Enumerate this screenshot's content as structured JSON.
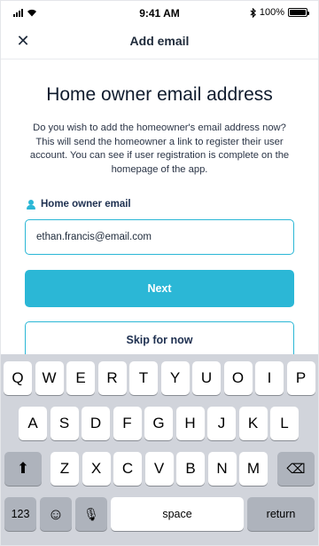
{
  "status_bar": {
    "time": "9:41 AM",
    "battery": "100%",
    "signal_icon": "signal-icon",
    "wifi_icon": "wifi-icon",
    "bluetooth_icon": "bluetooth-icon"
  },
  "nav": {
    "title": "Add email",
    "close_symbol": "✕"
  },
  "page": {
    "heading": "Home owner email address",
    "description": "Do you wish to add the homeowner's email address now? This will send the homeowner a link to register their user account. You can see if user registration is complete on the homepage of the app."
  },
  "form": {
    "field_label": "Home owner email",
    "email_value": "ethan.francis@email.com",
    "next_label": "Next",
    "skip_label": "Skip for now"
  },
  "keyboard": {
    "row1": [
      "Q",
      "W",
      "E",
      "R",
      "T",
      "Y",
      "U",
      "O",
      "I",
      "P"
    ],
    "row2": [
      "A",
      "S",
      "D",
      "F",
      "G",
      "H",
      "J",
      "K",
      "L"
    ],
    "row3": [
      "Z",
      "X",
      "C",
      "V",
      "B",
      "N",
      "M"
    ],
    "shift_symbol": "⬆",
    "delete_symbol": "⌫",
    "numbers_label": "123",
    "emoji_symbol": "☺",
    "mic_symbol": "🎙",
    "space_label": "space",
    "return_label": "return"
  },
  "colors": {
    "accent": "#2bb7d6",
    "text_dark": "#1e3050",
    "keyboard_bg": "#d1d4db"
  }
}
